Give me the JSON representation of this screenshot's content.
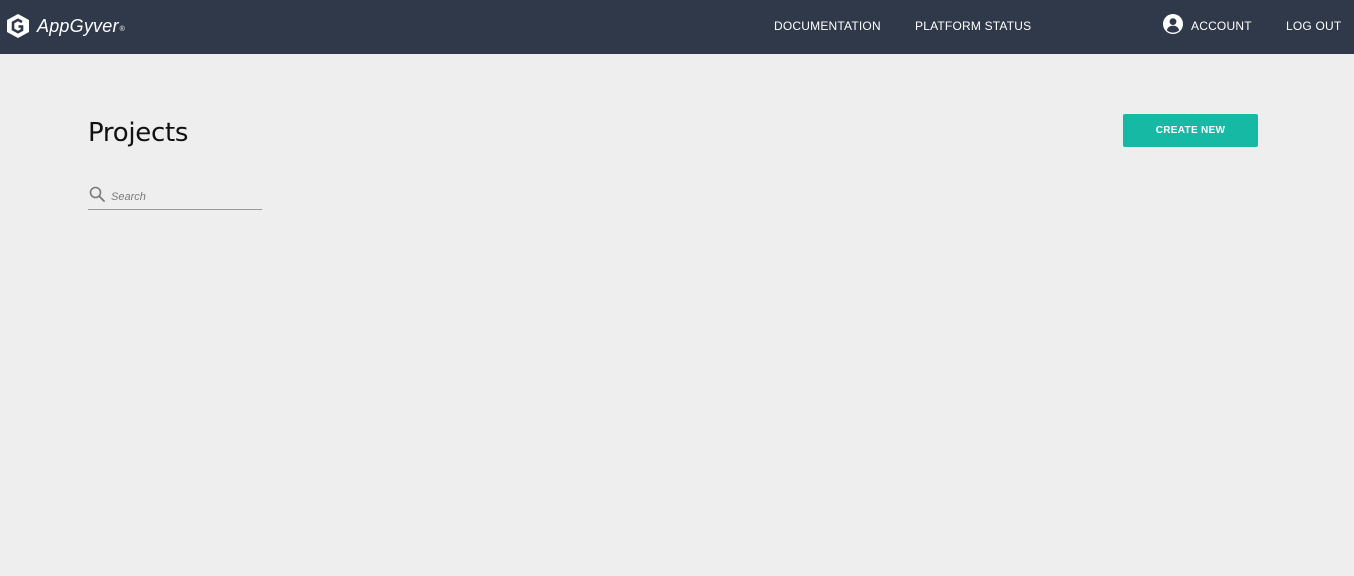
{
  "header": {
    "logo_text": "AppGyver",
    "logo_mark": "®",
    "nav": {
      "documentation": "DOCUMENTATION",
      "platform_status": "PLATFORM STATUS",
      "account": "ACCOUNT",
      "logout": "LOG OUT"
    },
    "icons": {
      "logo": "appgyver-logo-icon",
      "account": "user-circle-icon"
    }
  },
  "main": {
    "title": "Projects",
    "create_label": "CREATE NEW",
    "search": {
      "placeholder": "Search",
      "value": "",
      "icon": "search-icon"
    }
  },
  "colors": {
    "topbar": "#2f3949",
    "background": "#eeeeee",
    "accent": "#16b9a3"
  }
}
